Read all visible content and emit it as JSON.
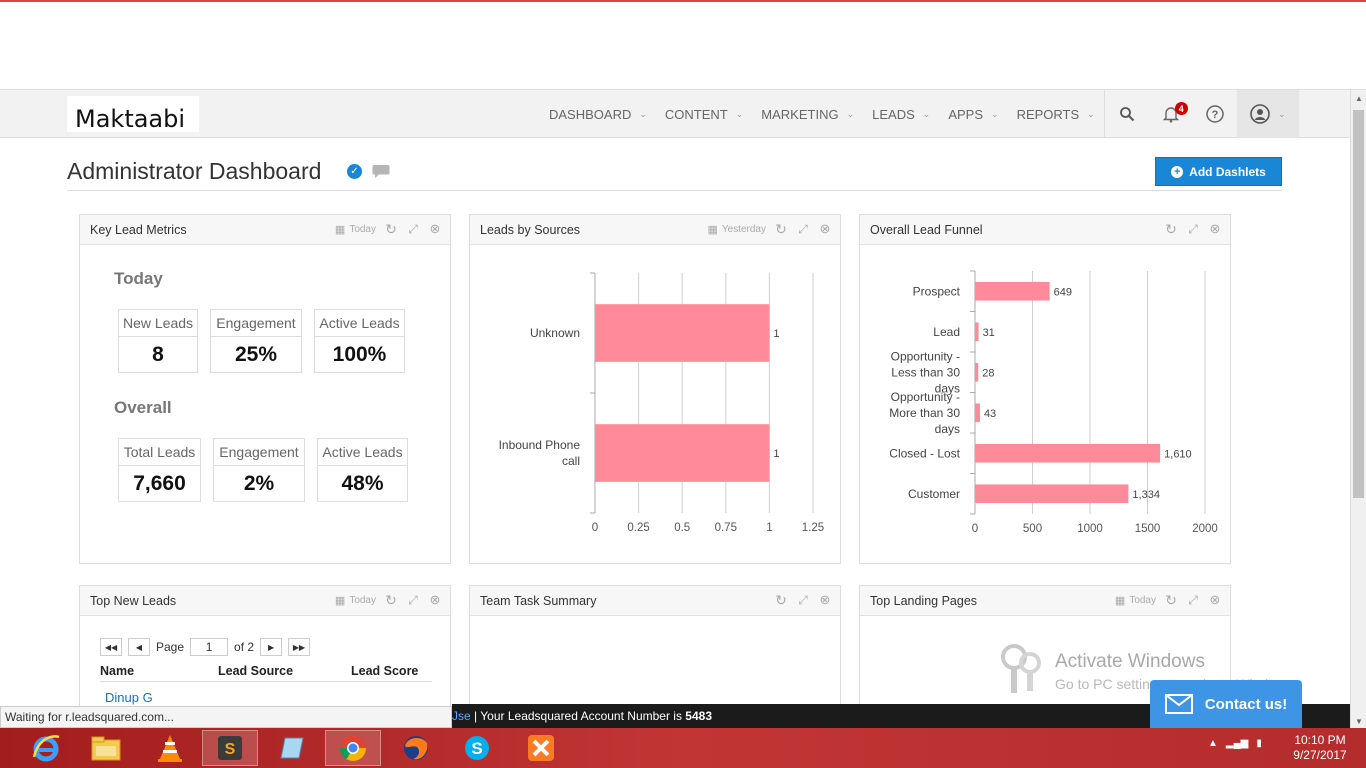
{
  "brand": {
    "name": "Maktaabi"
  },
  "nav": {
    "items": [
      {
        "label": "DASHBOARD"
      },
      {
        "label": "CONTENT"
      },
      {
        "label": "MARKETING"
      },
      {
        "label": "LEADS"
      },
      {
        "label": "APPS"
      },
      {
        "label": "REPORTS"
      }
    ],
    "notification_count": "4"
  },
  "page": {
    "title": "Administrator Dashboard",
    "add_dashlets_label": "Add Dashlets"
  },
  "dashlets": {
    "key_lead_metrics": {
      "title": "Key Lead Metrics",
      "period": "Today",
      "today": {
        "heading": "Today",
        "metrics": [
          {
            "label": "New Leads",
            "value": "8"
          },
          {
            "label": "Engagement",
            "value": "25%"
          },
          {
            "label": "Active Leads",
            "value": "100%"
          }
        ]
      },
      "overall": {
        "heading": "Overall",
        "metrics": [
          {
            "label": "Total Leads",
            "value": "7,660"
          },
          {
            "label": "Engagement",
            "value": "2%"
          },
          {
            "label": "Active Leads",
            "value": "48%"
          }
        ]
      }
    },
    "leads_by_sources": {
      "title": "Leads by Sources",
      "period": "Yesterday"
    },
    "overall_lead_funnel": {
      "title": "Overall Lead Funnel"
    },
    "top_new_leads": {
      "title": "Top New Leads",
      "period": "Today",
      "pager": {
        "page_label": "Page",
        "page_value": "1",
        "of_label": "of 2"
      },
      "columns": [
        "Name",
        "Lead Source",
        "Lead Score"
      ],
      "rows": [
        {
          "name": "Dinup G"
        }
      ]
    },
    "team_task_summary": {
      "title": "Team Task Summary"
    },
    "top_landing_pages": {
      "title": "Top Landing Pages",
      "period": "Today"
    }
  },
  "chart_data": [
    {
      "type": "bar",
      "orientation": "horizontal",
      "categories": [
        "Unknown",
        "Inbound Phone call"
      ],
      "values": [
        1,
        1
      ],
      "data_labels": [
        "1",
        "1"
      ],
      "xlim": [
        0,
        1.25
      ],
      "xticks": [
        "0",
        "0.25",
        "0.5",
        "0.75",
        "1",
        "1.25"
      ],
      "grid": true,
      "color": "#ff8a9a"
    },
    {
      "type": "bar",
      "orientation": "horizontal",
      "categories": [
        "Prospect",
        "Lead",
        "Opportunity - Less than 30 days",
        "Opportunity - More than 30 days",
        "Closed - Lost",
        "Customer"
      ],
      "values": [
        649,
        31,
        28,
        43,
        1610,
        1334
      ],
      "data_labels": [
        "649",
        "31",
        "28",
        "43",
        "1,610",
        "1,334"
      ],
      "xlim": [
        0,
        2000
      ],
      "xticks": [
        "0",
        "500",
        "1000",
        "1500",
        "2000"
      ],
      "grid": true,
      "color": "#ff8a9a"
    }
  ],
  "windows": {
    "activate_title": "Activate Windows",
    "activate_sub": "Go to PC settings to activate Windows."
  },
  "footer": {
    "status": "Waiting for r.leadsquared.com...",
    "account_prefix_fragment": "Jse",
    "account_text": "| Your Leadsquared Account Number is",
    "account_number": "5483",
    "contact_label": "Contact us!"
  },
  "taskbar": {
    "apps": [
      {
        "icon": "internet-explorer-icon"
      },
      {
        "icon": "file-explorer-icon"
      },
      {
        "icon": "vlc-icon"
      },
      {
        "icon": "sublime-text-icon"
      },
      {
        "icon": "notepad-icon"
      },
      {
        "icon": "chrome-icon"
      },
      {
        "icon": "firefox-icon"
      },
      {
        "icon": "skype-icon"
      },
      {
        "icon": "xampp-icon"
      }
    ],
    "time": "10:10 PM",
    "date": "9/27/2017"
  }
}
